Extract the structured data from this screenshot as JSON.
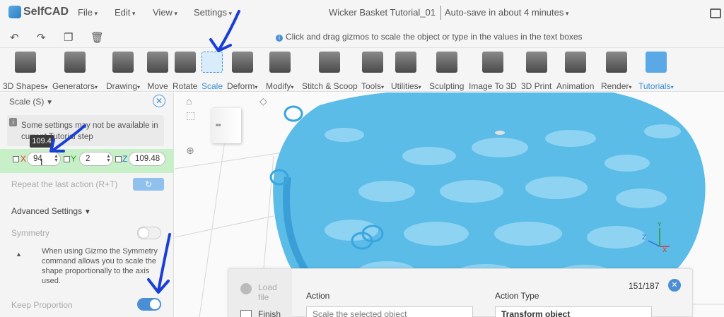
{
  "app": {
    "logo_text": "SelfCAD",
    "doc_title": "Wicker Basket Tutorial_01",
    "autosave": "Auto-save in about 4 minutes"
  },
  "menu": [
    "File",
    "Edit",
    "View",
    "Settings"
  ],
  "hint": "Click and drag gizmos to scale the object or type in the values in the text boxes",
  "toolbar": [
    {
      "label": "3D Shapes",
      "icon": "cube-icon"
    },
    {
      "label": "Generators",
      "icon": "generator-icon"
    },
    {
      "label": "Drawing",
      "icon": "drawing-icon"
    },
    {
      "label": "Move",
      "icon": "move-icon"
    },
    {
      "label": "Rotate",
      "icon": "rotate-icon"
    },
    {
      "label": "Scale",
      "icon": "scale-icon"
    },
    {
      "label": "Deform",
      "icon": "deform-icon"
    },
    {
      "label": "Modify",
      "icon": "modify-icon"
    },
    {
      "label": "Stitch & Scoop",
      "icon": "stitch-scoop-icon"
    },
    {
      "label": "Tools",
      "icon": "tools-icon"
    },
    {
      "label": "Utilities",
      "icon": "utilities-icon"
    },
    {
      "label": "Sculpting",
      "icon": "sculpting-icon"
    },
    {
      "label": "Image To 3D",
      "icon": "image-to-3d-icon"
    },
    {
      "label": "3D Print",
      "icon": "3d-print-icon"
    },
    {
      "label": "Animation",
      "icon": "animation-icon"
    },
    {
      "label": "Render",
      "icon": "render-icon"
    },
    {
      "label": "Tutorials",
      "icon": "tutorials-icon"
    }
  ],
  "panel": {
    "title": "Scale (S)",
    "notice": "Some settings may not be available in current Tutorial step",
    "tooltip": "109.4",
    "x_label": "X",
    "x_value": "94",
    "y_label": "Y",
    "y_value": "2",
    "z_label": "Z",
    "z_value": "109.48",
    "repeat_label": "Repeat the last action (R+T)",
    "advanced_label": "Advanced Settings",
    "symmetry_label": "Symmetry",
    "symmetry_on": false,
    "symmetry_desc": "When using Gizmo the Symmetry command allows you to scale the shape proportionally to the axis used.",
    "keep_label": "Keep Proportion",
    "keep_on": true
  },
  "tutorial": {
    "load_label": "Load file",
    "finish_label": "Finish",
    "counter": "151/187",
    "action_header": "Action",
    "action_type_header": "Transform object",
    "action_type_label": "Action Type",
    "action_value": "Scale the selected object"
  },
  "colors": {
    "accent": "#3c8fd6",
    "mesh": "#5bbce8",
    "highlight_row": "#c8f0c8"
  }
}
